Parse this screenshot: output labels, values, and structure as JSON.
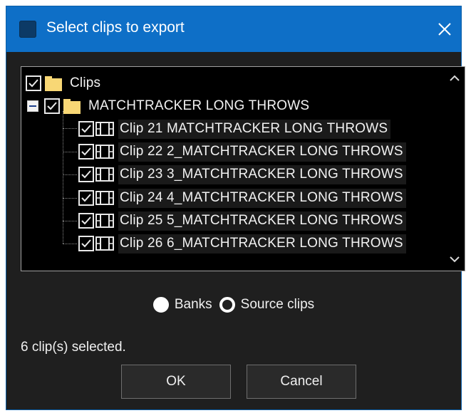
{
  "window": {
    "title": "Select clips to export",
    "titlebar_color": "#0e6fc7",
    "background_color": "#1f1f1f"
  },
  "tree": {
    "root": {
      "label": "Clips",
      "checked": true,
      "icon": "folder-icon"
    },
    "group": {
      "label": "MATCHTRACKER LONG THROWS",
      "checked": true,
      "expanded": true,
      "icon": "folder-icon"
    },
    "clips": [
      {
        "label": "Clip 21 MATCHTRACKER LONG THROWS",
        "checked": true,
        "icon": "film-icon"
      },
      {
        "label": "Clip 22 2_MATCHTRACKER LONG THROWS",
        "checked": true,
        "icon": "film-icon"
      },
      {
        "label": "Clip 23 3_MATCHTRACKER LONG THROWS",
        "checked": true,
        "icon": "film-icon"
      },
      {
        "label": "Clip 24 4_MATCHTRACKER LONG THROWS",
        "checked": true,
        "icon": "film-icon"
      },
      {
        "label": "Clip 25 5_MATCHTRACKER LONG THROWS",
        "checked": true,
        "icon": "film-icon"
      },
      {
        "label": "Clip 26 6_MATCHTRACKER LONG THROWS",
        "checked": true,
        "icon": "film-icon"
      }
    ]
  },
  "export_mode": {
    "options": [
      {
        "label": "Banks",
        "selected": true
      },
      {
        "label": "Source clips",
        "selected": false
      }
    ]
  },
  "status_text": "6 clip(s) selected.",
  "buttons": {
    "ok": "OK",
    "cancel": "Cancel"
  }
}
